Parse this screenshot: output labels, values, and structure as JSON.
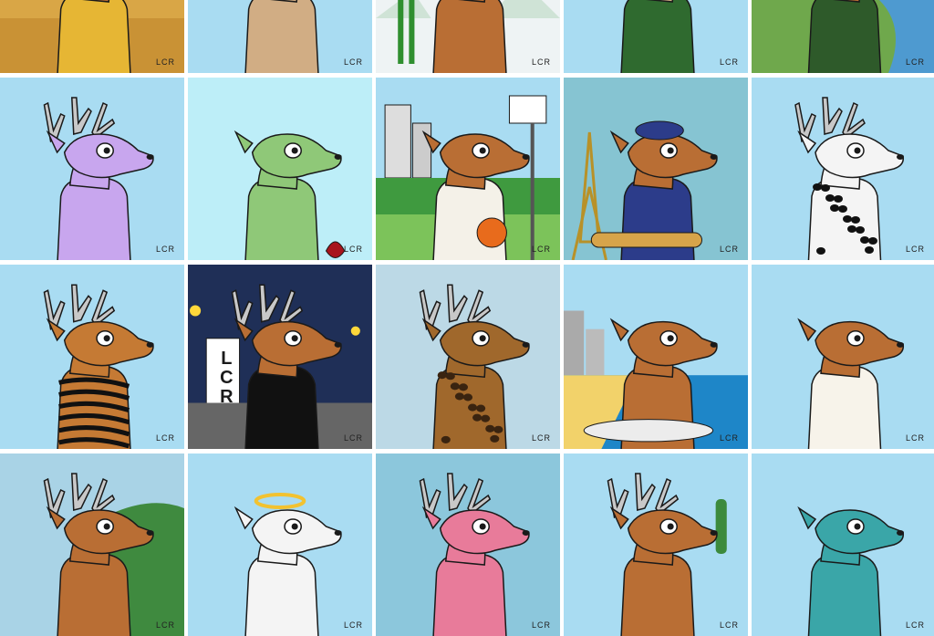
{
  "signature": "LCR",
  "sign_text": "LCR",
  "colors": {
    "sky_light": "#a9dcf2",
    "deer_brown": "#b96e34",
    "outline": "#1a1a1a",
    "antler": "#c8c8c8"
  },
  "tiles": [
    {
      "bg": "#d9a646",
      "body": "#b96e34",
      "outfit": "pharaoh"
    },
    {
      "bg": "#a9dcf2",
      "body": "#d1ad84",
      "outfit": "none"
    },
    {
      "bg": "#eef3f4",
      "body": "#b96e34",
      "outfit": "ski"
    },
    {
      "bg": "#a9dcf2",
      "body": "#d1ad84",
      "outfit": "green-jacket"
    },
    {
      "bg": "#6fa84c",
      "body": "#b96e34",
      "outfit": "soldier"
    },
    {
      "bg": "#a9dcf2",
      "body": "#c8a6ee",
      "outfit": "galaxy",
      "antlers": true
    },
    {
      "bg": "#bdeef8",
      "body": "#8fc878",
      "outfit": "zombie"
    },
    {
      "bg": "#a9dcf2",
      "body": "#b96e34",
      "outfit": "basketball"
    },
    {
      "bg": "#86c4d2",
      "body": "#b96e34",
      "outfit": "paris"
    },
    {
      "bg": "#a9dcf2",
      "body": "#f4f4f4",
      "outfit": "dalmatian",
      "antlers": true
    },
    {
      "bg": "#a9dcf2",
      "body": "#c57a34",
      "outfit": "tiger",
      "antlers": true
    },
    {
      "bg": "#1f2f57",
      "body": "#b96e34",
      "outfit": "night",
      "antlers": true
    },
    {
      "bg": "#bcd9e6",
      "body": "#a0682c",
      "outfit": "leopard",
      "antlers": true
    },
    {
      "bg": "#a9dcf2",
      "body": "#b96e34",
      "outfit": "beach"
    },
    {
      "bg": "#a9dcf2",
      "body": "#b96e34",
      "outfit": "white-shirt"
    },
    {
      "bg": "#a9d3e6",
      "body": "#b96e34",
      "outfit": "rio",
      "antlers": true
    },
    {
      "bg": "#a9dcf2",
      "body": "#f4f4f4",
      "outfit": "angel"
    },
    {
      "bg": "#8cc7dc",
      "body": "#e87b9a",
      "outfit": "pink",
      "antlers": true
    },
    {
      "bg": "#a9dcf2",
      "body": "#b96e34",
      "outfit": "desert",
      "antlers": true
    },
    {
      "bg": "#a9dcf2",
      "body": "#3aa6a8",
      "outfit": "teal"
    }
  ]
}
